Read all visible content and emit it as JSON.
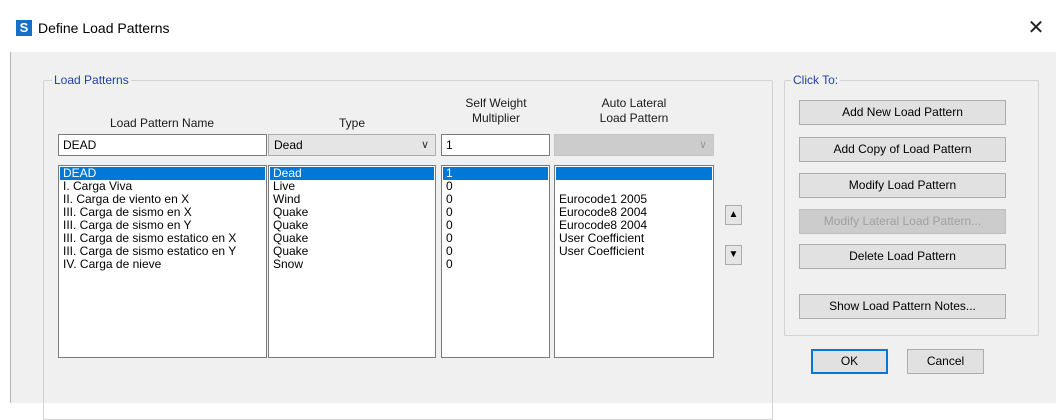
{
  "window": {
    "title": "Define Load Patterns",
    "app_icon": "S",
    "close_glyph": "✕"
  },
  "load_patterns": {
    "group_label": "Load Patterns",
    "headers": {
      "name": "Load Pattern Name",
      "type": "Type",
      "multiplier_line1": "Self Weight",
      "multiplier_line2": "Multiplier",
      "auto_lateral_line1": "Auto Lateral",
      "auto_lateral_line2": "Load Pattern"
    },
    "edit": {
      "name": "DEAD",
      "type": "Dead",
      "multiplier": "1",
      "auto_lateral": ""
    },
    "rows": [
      {
        "name": "DEAD",
        "type": "Dead",
        "multiplier": "1",
        "auto_lateral": ""
      },
      {
        "name": "I. Carga Viva",
        "type": "Live",
        "multiplier": "0",
        "auto_lateral": ""
      },
      {
        "name": "II. Carga de viento en X",
        "type": "Wind",
        "multiplier": "0",
        "auto_lateral": "Eurocode1 2005"
      },
      {
        "name": "III. Carga de sismo en X",
        "type": "Quake",
        "multiplier": "0",
        "auto_lateral": "Eurocode8 2004"
      },
      {
        "name": "III. Carga de sismo en Y",
        "type": "Quake",
        "multiplier": "0",
        "auto_lateral": "Eurocode8 2004"
      },
      {
        "name": "III. Carga de sismo estatico en X",
        "type": "Quake",
        "multiplier": "0",
        "auto_lateral": "User Coefficient"
      },
      {
        "name": "III. Carga de sismo estatico en Y",
        "type": "Quake",
        "multiplier": "0",
        "auto_lateral": "User Coefficient"
      },
      {
        "name": "IV. Carga de nieve",
        "type": "Snow",
        "multiplier": "0",
        "auto_lateral": ""
      }
    ],
    "selected_index": 0,
    "move_up_icon": "arrow-up-icon",
    "move_down_icon": "arrow-down-icon"
  },
  "click_to": {
    "group_label": "Click To:",
    "add_new": "Add New Load Pattern",
    "add_copy": "Add Copy of Load Pattern",
    "modify": "Modify Load Pattern",
    "modify_lateral": "Modify Lateral Load Pattern...",
    "delete": "Delete Load Pattern",
    "show_notes": "Show Load Pattern Notes..."
  },
  "ok": "OK",
  "cancel": "Cancel",
  "colors": {
    "accent": "#0078d7",
    "group_label": "#1d3fb0",
    "app_icon": "#1570c9"
  }
}
